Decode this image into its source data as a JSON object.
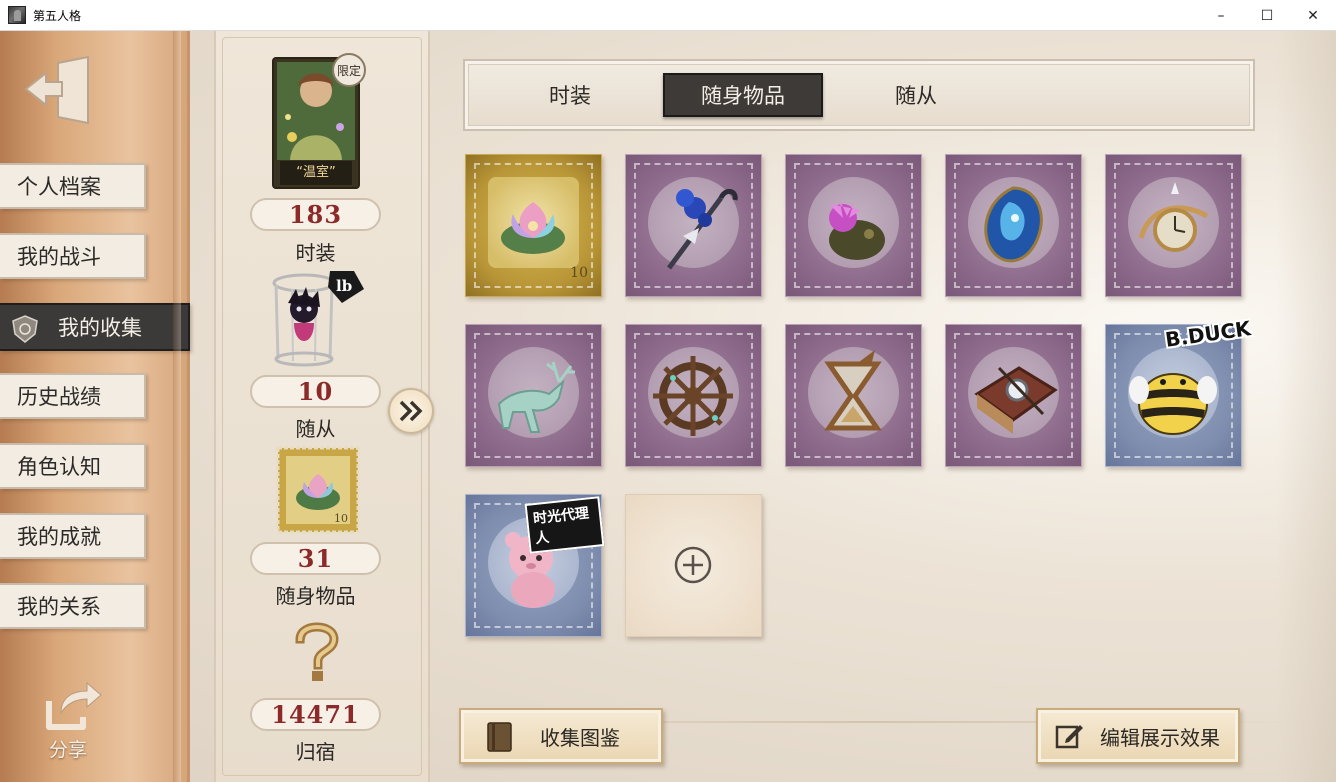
{
  "window": {
    "title": "第五人格",
    "controls": {
      "minimize": "–",
      "maximize": "☐",
      "close": "✕"
    }
  },
  "sidebar": {
    "exit_icon": "exit-door-icon",
    "items": [
      {
        "label": "个人档案"
      },
      {
        "label": "我的战斗"
      },
      {
        "label": "我的收集",
        "active": true
      },
      {
        "label": "历史战绩"
      },
      {
        "label": "角色认知"
      },
      {
        "label": "我的成就"
      },
      {
        "label": "我的关系"
      }
    ],
    "share_label": "分享"
  },
  "stats": {
    "costume_badge": "限定",
    "costume_name": "“温室”",
    "follower_tag": "lb",
    "items": [
      {
        "value": "183",
        "label": "时装"
      },
      {
        "value": "10",
        "label": "随从"
      },
      {
        "value": "31",
        "label": "随身物品"
      },
      {
        "value": "14471",
        "label": "归宿"
      }
    ]
  },
  "tabs": [
    {
      "label": "时装"
    },
    {
      "label": "随身物品",
      "active": true
    },
    {
      "label": "随从"
    }
  ],
  "grid": {
    "items": [
      {
        "name": "lotus",
        "style": "gold"
      },
      {
        "name": "blue-rose-cane",
        "style": "purple"
      },
      {
        "name": "thistle",
        "style": "purple"
      },
      {
        "name": "blue-crystal-heart",
        "style": "purple"
      },
      {
        "name": "pocket-watch",
        "style": "purple"
      },
      {
        "name": "deer",
        "style": "purple"
      },
      {
        "name": "ship-wheel",
        "style": "purple"
      },
      {
        "name": "hourglass",
        "style": "purple"
      },
      {
        "name": "book-compass",
        "style": "purple"
      },
      {
        "name": "bee-plush",
        "style": "blue",
        "tag": "B.DUCK"
      },
      {
        "name": "pink-bear",
        "style": "blue",
        "tag": "时光代理人"
      },
      {
        "name": "empty-slot",
        "style": "empty"
      }
    ],
    "gold_value_mark": "10"
  },
  "buttons": {
    "collection": "收集图鉴",
    "edit": "编辑展示效果"
  }
}
